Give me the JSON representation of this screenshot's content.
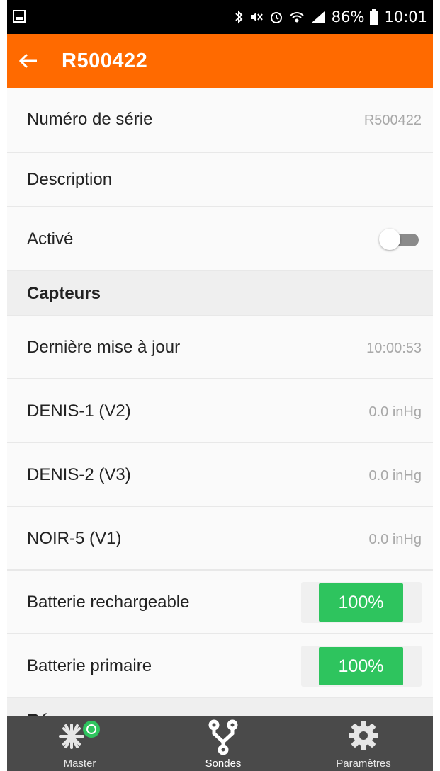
{
  "status_bar": {
    "left_icon": "image-icon",
    "icons": [
      "bluetooth-icon",
      "mute-icon",
      "alarm-icon",
      "wifi-icon",
      "signal-icon"
    ],
    "battery": "86%",
    "time": "10:01"
  },
  "app_bar": {
    "back_icon": "arrow-left-icon",
    "title": "R500422",
    "color": "#ff6a00"
  },
  "fields": {
    "serial_label": "Numéro de série",
    "serial_value": "R500422",
    "description_label": "Description",
    "description_value": "",
    "active_label": "Activé",
    "active_on": false
  },
  "sensors": {
    "header": "Capteurs",
    "last_update_label": "Dernière mise à jour",
    "last_update_value": "10:00:53",
    "items": [
      {
        "label": "DENIS-1 (V2)",
        "value": "0.0 inHg"
      },
      {
        "label": "DENIS-2 (V3)",
        "value": "0.0 inHg"
      },
      {
        "label": "NOIR-5 (V1)",
        "value": "0.0 inHg"
      }
    ],
    "batteries": [
      {
        "label": "Batterie rechargeable",
        "value": "100%",
        "level": 1.0
      },
      {
        "label": "Batterie primaire",
        "value": "100%",
        "level": 1.0
      }
    ],
    "battery_color": "#2ec45e"
  },
  "next_section_partial": "Réseau",
  "bottom_nav": {
    "items": [
      {
        "label": "Master",
        "icon": "master-asterisk-icon",
        "active": false
      },
      {
        "label": "Sondes",
        "icon": "probes-fork-icon",
        "active": true
      },
      {
        "label": "Paramètres",
        "icon": "gear-icon",
        "active": false
      }
    ]
  }
}
